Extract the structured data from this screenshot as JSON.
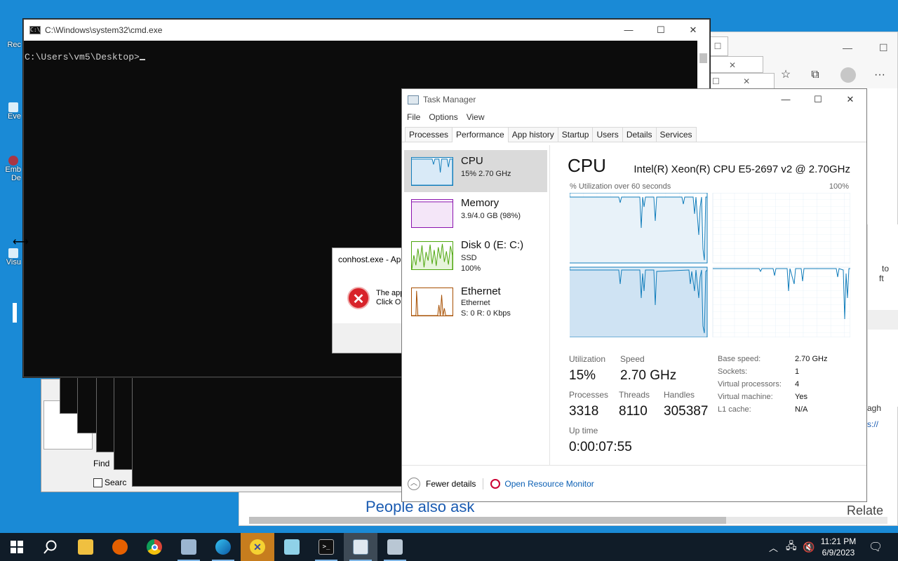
{
  "desktop": {
    "icons": [
      {
        "label": "Rec"
      },
      {
        "label": "Eve"
      },
      {
        "label": "Emb"
      },
      {
        "label": "De"
      },
      {
        "label": "Visu"
      }
    ]
  },
  "browser": {
    "people_also_ask": "People also ask",
    "related": "Relate",
    "side_text_1": "to",
    "side_text_2": "ft",
    "side_text_3": "agh",
    "side_text_4": "s://"
  },
  "find_dialog": {
    "find_label": "Find",
    "search_checkbox_label": "Searc"
  },
  "cmd": {
    "title": "C:\\Windows\\system32\\cmd.exe",
    "prompt": "C:\\Users\\vm5\\Desktop>"
  },
  "error_dialog": {
    "title": "conhost.exe - Ap",
    "line1": "The app",
    "line2": "Click O"
  },
  "task_manager": {
    "title": "Task Manager",
    "menu": [
      "File",
      "Options",
      "View"
    ],
    "tabs": [
      "Processes",
      "Performance",
      "App history",
      "Startup",
      "Users",
      "Details",
      "Services"
    ],
    "active_tab": "Performance",
    "resources": [
      {
        "name": "CPU",
        "line1": "15%  2.70 GHz",
        "color": "#117dbb"
      },
      {
        "name": "Memory",
        "line1": "3.9/4.0 GB (98%)",
        "color": "#8b12ae"
      },
      {
        "name": "Disk 0 (E: C:)",
        "line1": "SSD",
        "line2": "100%",
        "color": "#4da60c"
      },
      {
        "name": "Ethernet",
        "line1": "Ethernet",
        "line2": "S: 0  R: 0 Kbps",
        "color": "#a74f01"
      }
    ],
    "cpu": {
      "heading": "CPU",
      "model": "Intel(R) Xeon(R) CPU E5-2697 v2 @ 2.70GHz",
      "graph_label": "% Utilization over 60 seconds",
      "graph_max": "100%",
      "utilization_label": "Utilization",
      "utilization": "15%",
      "speed_label": "Speed",
      "speed": "2.70 GHz",
      "processes_label": "Processes",
      "processes": "3318",
      "threads_label": "Threads",
      "threads": "8110",
      "handles_label": "Handles",
      "handles": "305387",
      "uptime_label": "Up time",
      "uptime": "0:00:07:55",
      "details": [
        {
          "k": "Base speed:",
          "v": "2.70 GHz"
        },
        {
          "k": "Sockets:",
          "v": "1"
        },
        {
          "k": "Virtual processors:",
          "v": "4"
        },
        {
          "k": "Virtual machine:",
          "v": "Yes"
        },
        {
          "k": "L1 cache:",
          "v": "N/A"
        }
      ]
    },
    "fewer_details": "Fewer details",
    "open_resource_monitor": "Open Resource Monitor"
  },
  "taskbar": {
    "items": [
      "start-icon",
      "search-icon",
      "file-explorer-icon",
      "firefox-icon",
      "chrome-icon",
      "app-icon",
      "edge-icon",
      "yellow-app-icon",
      "notepad-icon",
      "cmd-icon",
      "task-manager-icon",
      "task-manager-2-icon"
    ],
    "time": "11:21 PM",
    "date": "6/9/2023"
  }
}
